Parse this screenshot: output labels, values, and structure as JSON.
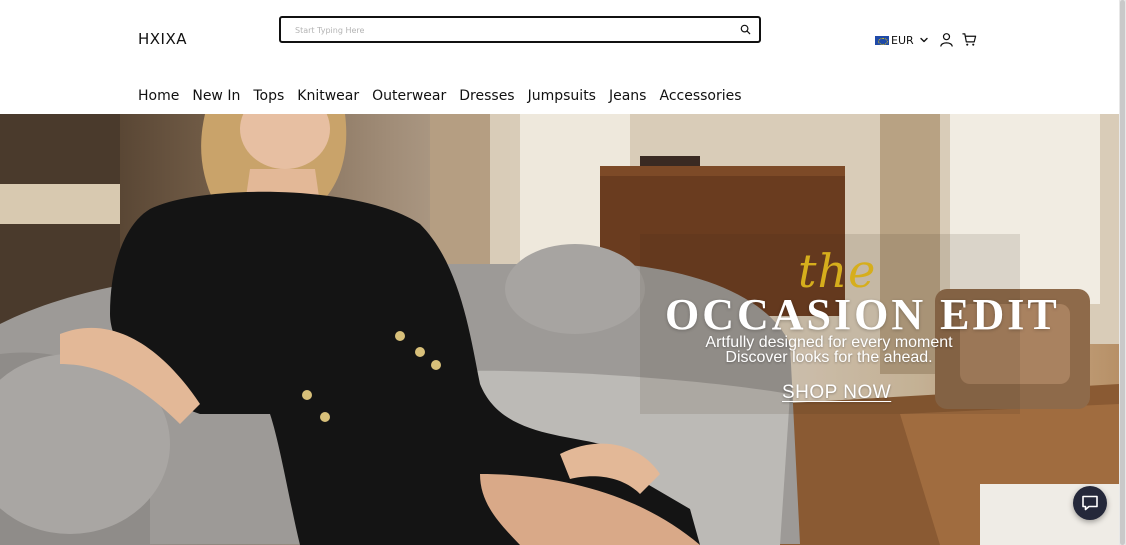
{
  "header": {
    "logo": "HXIXA",
    "search": {
      "placeholder": "Start Typing Here",
      "value": ""
    },
    "currency": {
      "label": "EUR",
      "flag": "eu-flag-icon"
    },
    "icons": [
      "search-icon",
      "chevron-down-icon",
      "user-icon",
      "cart-icon"
    ]
  },
  "nav": {
    "items": [
      {
        "label": "Home"
      },
      {
        "label": "New In"
      },
      {
        "label": "Tops"
      },
      {
        "label": "Knitwear"
      },
      {
        "label": "Outerwear"
      },
      {
        "label": "Dresses"
      },
      {
        "label": "Jumpsuits"
      },
      {
        "label": "Jeans"
      },
      {
        "label": "Accessories"
      }
    ]
  },
  "hero": {
    "kicker": "the",
    "title": "OCCASION  EDIT",
    "subtitle_line1": "Artfully designed for every moment",
    "subtitle_line2": "Discover looks for the ahead.",
    "cta": "SHOP NOW"
  },
  "chat": {
    "icon": "chat-bubble-icon"
  },
  "colors": {
    "accent_gold": "#d6ae1c",
    "chat_bg": "#24283a",
    "text": "#111111"
  }
}
